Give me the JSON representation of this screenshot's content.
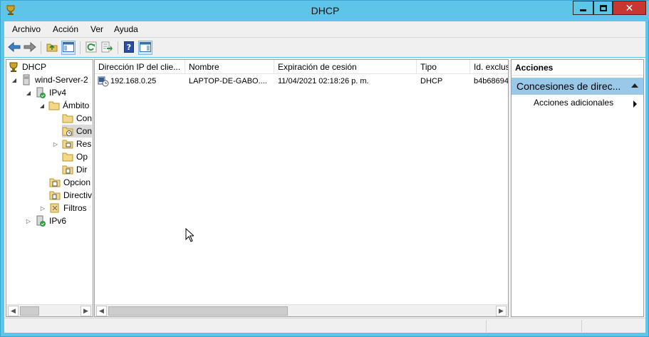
{
  "window": {
    "title": "DHCP"
  },
  "menu": [
    "Archivo",
    "Acción",
    "Ver",
    "Ayuda"
  ],
  "toolbar": {
    "buttons": [
      "back-arrow-icon",
      "forward-arrow-icon",
      "up-folder-icon",
      "show-hide-tree-icon",
      "refresh-icon",
      "export-list-icon",
      "help-icon",
      "show-hide-action-pane-icon"
    ]
  },
  "tree": {
    "items": [
      {
        "label": "DHCP"
      },
      {
        "label": "wind-Server-2"
      },
      {
        "label": "IPv4"
      },
      {
        "label": "Ámbito"
      },
      {
        "label": "Con"
      },
      {
        "label": "Con"
      },
      {
        "label": "Res"
      },
      {
        "label": "Op"
      },
      {
        "label": "Dir"
      },
      {
        "label": "Opcion"
      },
      {
        "label": "Directiv"
      },
      {
        "label": "Filtros"
      },
      {
        "label": "IPv6"
      }
    ]
  },
  "list": {
    "columns": [
      "Dirección IP del clie...",
      "Nombre",
      "Expiración de cesión",
      "Tipo",
      "Id. exclus"
    ],
    "rows": [
      {
        "ip": "192.168.0.25",
        "name": "LAPTOP-DE-GABO....",
        "expiration": "11/04/2021 02:18:26 p. m.",
        "type": "DHCP",
        "id": "b4b68694"
      }
    ]
  },
  "actions": {
    "header": "Acciones",
    "section": "Concesiones de direc...",
    "items": [
      "Acciones adicionales"
    ]
  },
  "colors": {
    "titlebar": "#5fc5e8",
    "close_button": "#c7372f",
    "selected_section": "#9ac8e8"
  }
}
